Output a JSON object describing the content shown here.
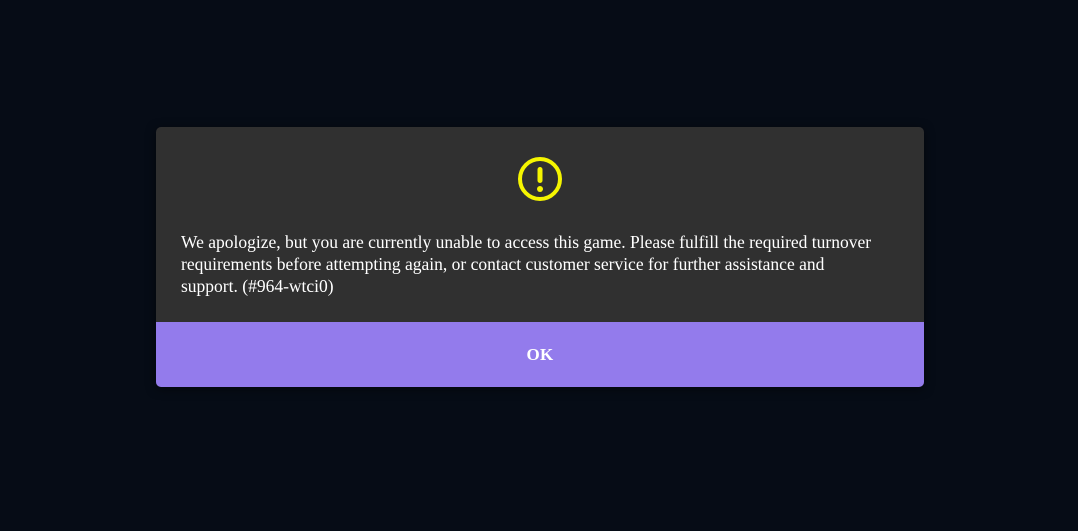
{
  "dialog": {
    "icon": "exclamation-circle-icon",
    "icon_color": "#f5f500",
    "message": "We apologize, but you are currently unable to access this game. Please fulfill the required turnover requirements before attempting again, or contact customer service for further assistance and support. (#964-wtci0)",
    "ok_label": "OK"
  },
  "colors": {
    "backdrop": "#060c16",
    "dialog_background": "#303030",
    "button_background": "#937bec",
    "text": "#ffffff"
  }
}
